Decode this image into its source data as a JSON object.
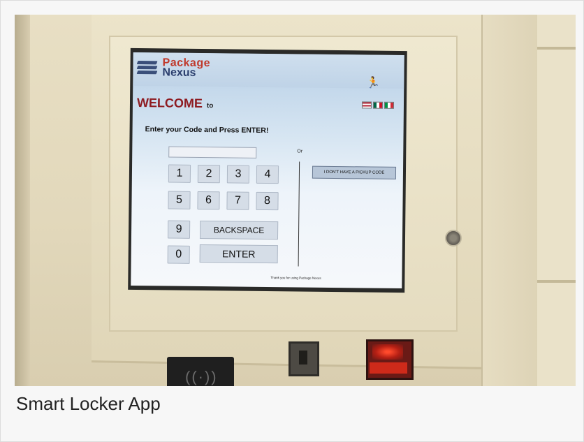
{
  "caption": "Smart Locker App",
  "kiosk": {
    "logo": {
      "word1": "Package",
      "word2": "Nexus"
    },
    "welcome": "WELCOME",
    "welcome_to": "to",
    "prompt": "Enter your Code and Press ENTER!",
    "code_input": {
      "value": "",
      "placeholder": ""
    },
    "or_label": "Or",
    "no_code_button": "I DON'T HAVE A PICKUP CODE",
    "keypad": {
      "keys": [
        "1",
        "2",
        "3",
        "4",
        "5",
        "6",
        "7",
        "8",
        "9",
        "0"
      ],
      "backspace": "BACKSPACE",
      "enter": "ENTER"
    },
    "footer": "Thank you for using Package Nexus",
    "languages": [
      "flag-us-icon",
      "flag-mx-icon",
      "flag-it-icon"
    ],
    "colors": {
      "accent_red": "#8e1c22",
      "brand_blue": "#2b3f6e",
      "key_bg": "#d5dde7"
    }
  }
}
